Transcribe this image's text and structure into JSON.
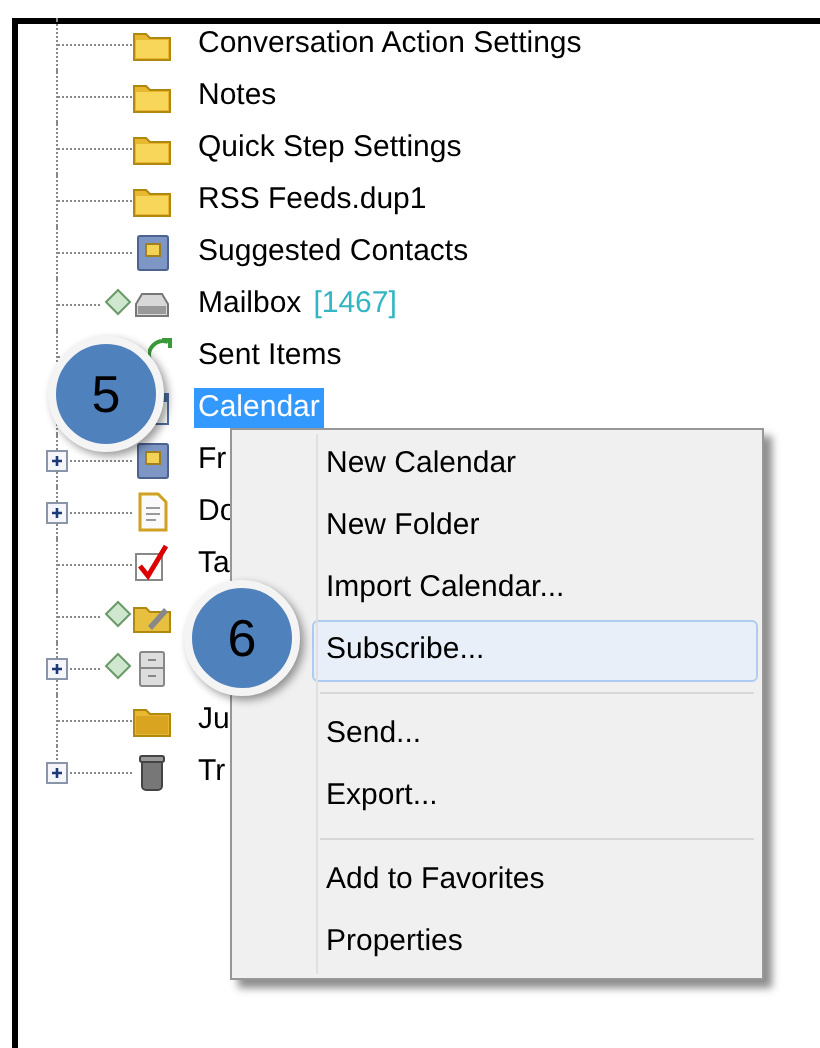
{
  "tree": {
    "items": [
      {
        "label": "Conversation Action Settings",
        "kind": "folder",
        "expandable": false,
        "synced": false,
        "selected": false
      },
      {
        "label": "Notes",
        "kind": "folder",
        "expandable": false,
        "synced": false,
        "selected": false
      },
      {
        "label": "Quick Step Settings",
        "kind": "folder",
        "expandable": false,
        "synced": false,
        "selected": false
      },
      {
        "label": "RSS Feeds.dup1",
        "kind": "folder",
        "expandable": false,
        "synced": false,
        "selected": false
      },
      {
        "label": "Suggested Contacts",
        "kind": "contacts",
        "expandable": false,
        "synced": false,
        "selected": false
      },
      {
        "label": "Mailbox",
        "count": "[1467]",
        "kind": "mailbox",
        "expandable": false,
        "synced": true,
        "selected": false
      },
      {
        "label": "Sent Items",
        "kind": "sent",
        "expandable": false,
        "synced": false,
        "selected": false
      },
      {
        "label": "Calendar",
        "kind": "calendar",
        "expandable": false,
        "synced": false,
        "selected": true
      },
      {
        "label": "Fr",
        "kind": "contacts",
        "expandable": true,
        "synced": false,
        "selected": false
      },
      {
        "label": "Do",
        "kind": "document",
        "expandable": true,
        "synced": false,
        "selected": false
      },
      {
        "label": "Ta",
        "kind": "tasks",
        "expandable": false,
        "synced": false,
        "selected": false
      },
      {
        "kind": "drafts",
        "expandable": false,
        "synced": true,
        "selected": false
      },
      {
        "kind": "archive",
        "expandable": true,
        "synced": true,
        "selected": false
      },
      {
        "label": "Ju",
        "kind": "junk",
        "expandable": false,
        "synced": false,
        "selected": false
      },
      {
        "label": "Tr",
        "kind": "trash",
        "expandable": true,
        "synced": false,
        "selected": false
      }
    ]
  },
  "context_menu": {
    "groups": [
      [
        {
          "label": "New Calendar",
          "highlighted": false
        },
        {
          "label": "New Folder",
          "highlighted": false
        },
        {
          "label": "Import Calendar...",
          "highlighted": false
        },
        {
          "label": "Subscribe...",
          "highlighted": true
        }
      ],
      [
        {
          "label": "Send...",
          "highlighted": false
        },
        {
          "label": "Export...",
          "highlighted": false
        }
      ],
      [
        {
          "label": "Add to Favorites",
          "highlighted": false
        },
        {
          "label": "Properties",
          "highlighted": false
        }
      ]
    ]
  },
  "step_badges": [
    {
      "number": "5"
    },
    {
      "number": "6"
    }
  ]
}
